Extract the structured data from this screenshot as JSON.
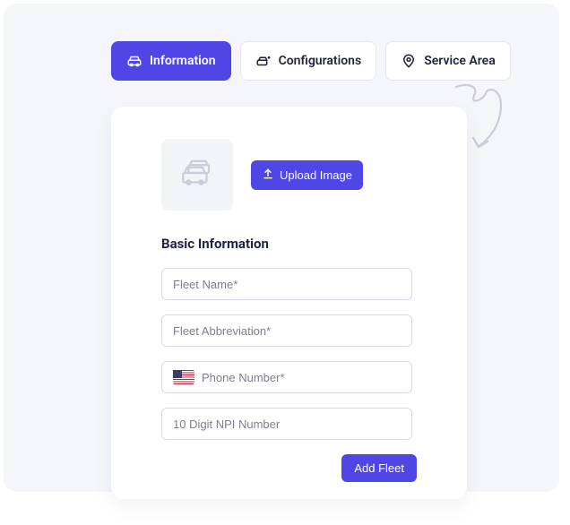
{
  "tabs": {
    "information": "Information",
    "configurations": "Configurations",
    "service_area": "Service Area"
  },
  "upload": {
    "button_label": "Upload Image"
  },
  "section": {
    "title": "Basic Information"
  },
  "fields": {
    "fleet_name": {
      "placeholder": "Fleet Name*",
      "value": ""
    },
    "fleet_abbreviation": {
      "placeholder": "Fleet Abbreviation*",
      "value": ""
    },
    "phone": {
      "placeholder": "Phone Number*",
      "value": ""
    },
    "npi": {
      "placeholder": "10 Digit NPI Number",
      "value": ""
    }
  },
  "submit": {
    "label": "Add Fleet"
  },
  "colors": {
    "accent": "#4f46e5"
  }
}
